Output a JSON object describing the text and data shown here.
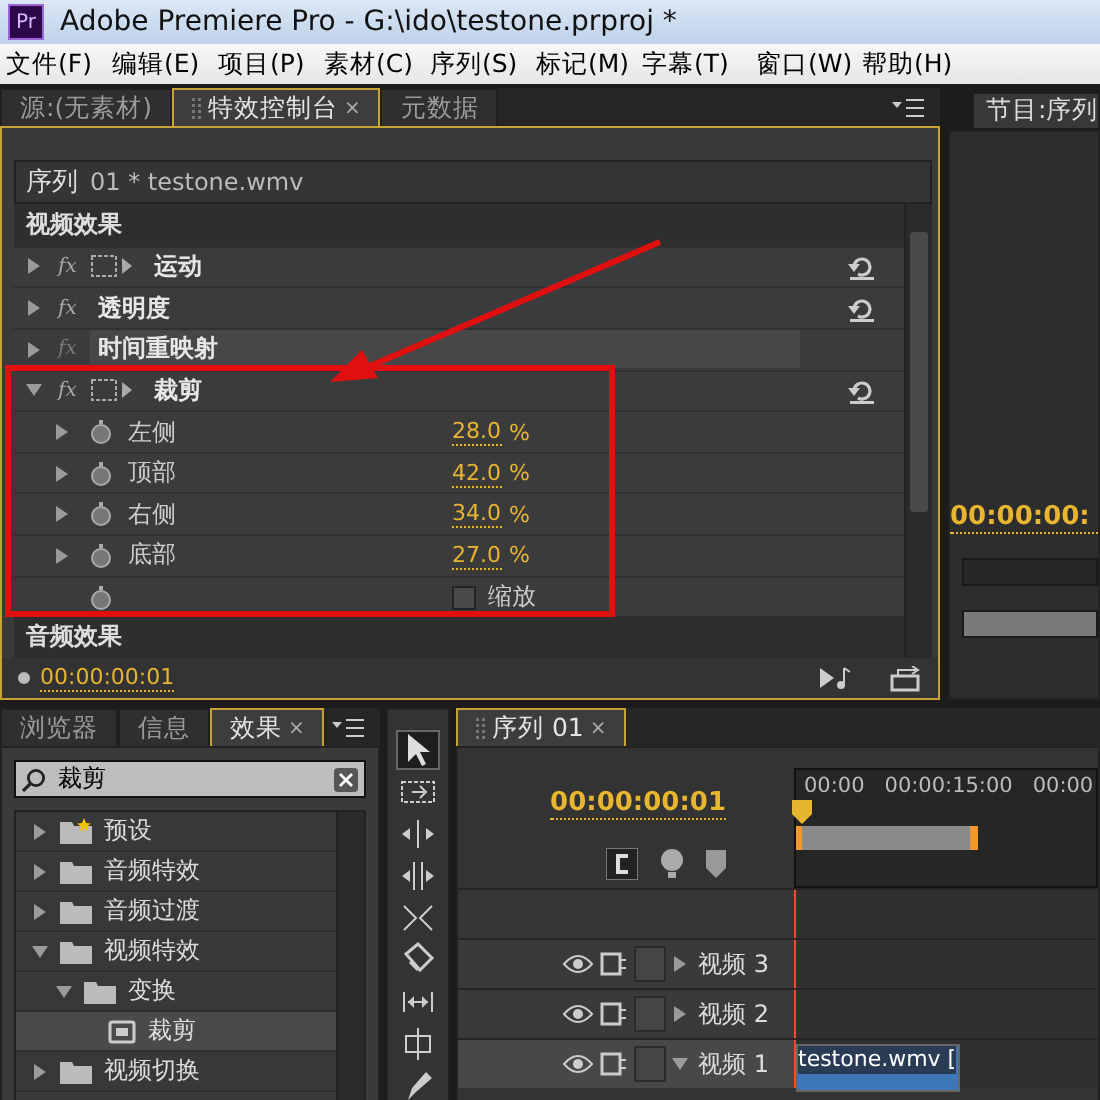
{
  "window": {
    "app_badge": "Pr",
    "title": "Adobe Premiere Pro - G:\\ido\\testone.prproj *"
  },
  "menu": [
    "文件(F)",
    "编辑(E)",
    "项目(P)",
    "素材(C)",
    "序列(S)",
    "标记(M)",
    "字幕(T)",
    "窗口(W)",
    "帮助(H)"
  ],
  "effect_controls": {
    "tabs": [
      {
        "label": "源:(无素材)",
        "selected": false
      },
      {
        "label": "特效控制台",
        "selected": true,
        "close": "×"
      },
      {
        "label": "元数据",
        "selected": false
      }
    ],
    "clip": {
      "sequence": "序列",
      "name": "01 * testone.wmv"
    },
    "video_header": "视频效果",
    "effects": [
      {
        "name": "运动",
        "fx": "fx",
        "enabled": true,
        "transform_icon": true,
        "expanded": false,
        "resettable": true,
        "selected": false
      },
      {
        "name": "透明度",
        "fx": "fx",
        "enabled": true,
        "transform_icon": false,
        "expanded": false,
        "resettable": true,
        "selected": false
      },
      {
        "name": "时间重映射",
        "fx": "fx",
        "enabled": false,
        "transform_icon": false,
        "expanded": false,
        "resettable": false,
        "selected": true
      },
      {
        "name": "裁剪",
        "fx": "fx",
        "enabled": true,
        "transform_icon": true,
        "expanded": true,
        "resettable": true,
        "selected": false,
        "params": [
          {
            "kind": "value",
            "name": "左侧",
            "value": "28.0",
            "unit": "%"
          },
          {
            "kind": "value",
            "name": "顶部",
            "value": "42.0",
            "unit": "%"
          },
          {
            "kind": "value",
            "name": "右侧",
            "value": "34.0",
            "unit": "%"
          },
          {
            "kind": "value",
            "name": "底部",
            "value": "27.0",
            "unit": "%"
          },
          {
            "kind": "checkbox",
            "label": "缩放",
            "checked": false
          }
        ]
      }
    ],
    "audio_header": "音频效果",
    "timecode": "00:00:00:01"
  },
  "program": {
    "tab": "节目:序列",
    "timecode": "00:00:00:"
  },
  "effects_panel": {
    "tabs": [
      {
        "label": "浏览器",
        "selected": false
      },
      {
        "label": "信息",
        "selected": false
      },
      {
        "label": "效果",
        "selected": true,
        "close": "×"
      }
    ],
    "search": {
      "value": "裁剪"
    },
    "tree": [
      {
        "kind": "preset-folder",
        "label": "预设",
        "expanded": false,
        "selected": false
      },
      {
        "kind": "folder",
        "label": "音频特效",
        "expanded": false,
        "selected": false
      },
      {
        "kind": "folder",
        "label": "音频过渡",
        "expanded": false,
        "selected": false
      },
      {
        "kind": "folder",
        "label": "视频特效",
        "expanded": true,
        "selected": false,
        "children": [
          {
            "kind": "folder",
            "label": "变换",
            "expanded": true,
            "selected": false,
            "children": [
              {
                "kind": "effect",
                "label": "裁剪",
                "expanded": false,
                "selected": true
              }
            ]
          }
        ]
      },
      {
        "kind": "folder",
        "label": "视频切换",
        "expanded": false,
        "selected": false
      }
    ]
  },
  "tools": [
    {
      "kind": "selection",
      "selected": true
    },
    {
      "kind": "track-select",
      "selected": false
    },
    {
      "kind": "ripple",
      "selected": false
    },
    {
      "kind": "rolling",
      "selected": false
    },
    {
      "kind": "rate-stretch",
      "selected": false
    },
    {
      "kind": "razor",
      "selected": false
    },
    {
      "kind": "slip",
      "selected": false
    },
    {
      "kind": "slide",
      "selected": false
    },
    {
      "kind": "pen",
      "selected": false
    }
  ],
  "timeline": {
    "tab": {
      "label": "序列 01",
      "close": "×"
    },
    "timecode": "00:00:00:01",
    "ruler": [
      "00:00",
      "00:00:15:00",
      "00:00"
    ],
    "tracks": [
      {
        "label": "视频 3",
        "expanded": false,
        "targeted": false
      },
      {
        "label": "视频 2",
        "expanded": false,
        "targeted": false
      },
      {
        "label": "视频 1",
        "expanded": true,
        "targeted": true,
        "clip": "testone.wmv ["
      }
    ]
  }
}
